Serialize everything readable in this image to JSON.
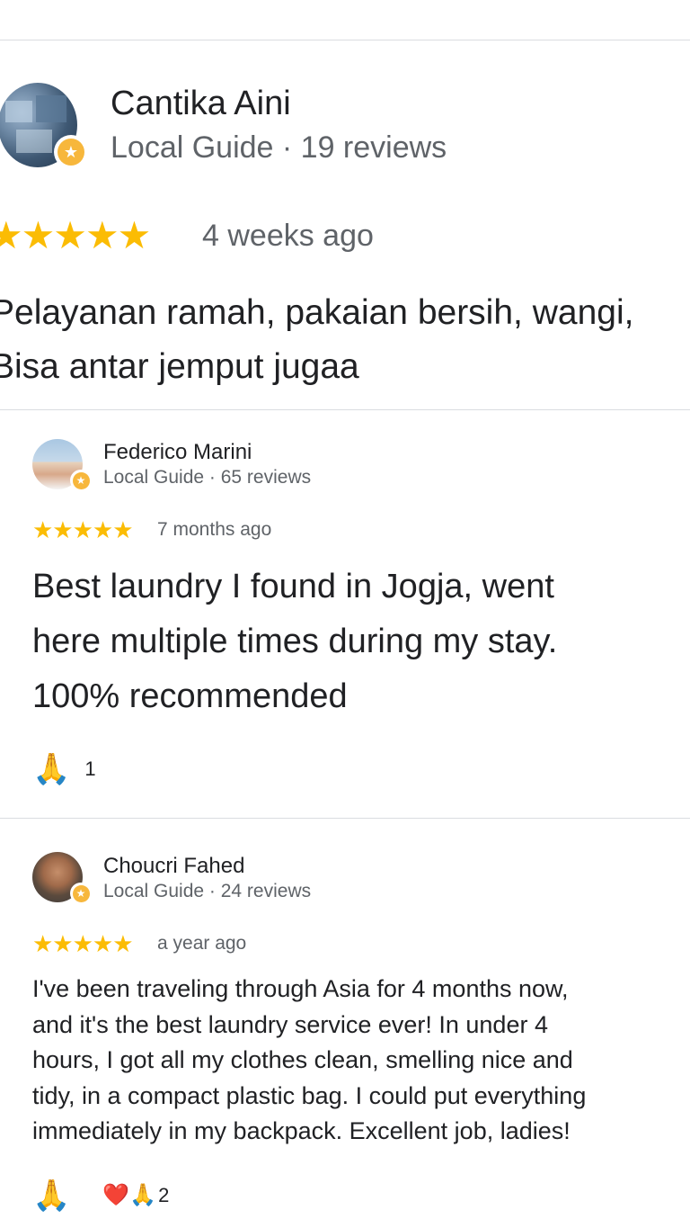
{
  "reviews": [
    {
      "name": "Cantika Aini",
      "meta": "Local Guide · 19 reviews",
      "stars": "★★★★★",
      "rating": 5,
      "time": "4 weeks ago",
      "lines": [
        "Pelayanan ramah, pakaian bersih, wangi,",
        "Bisa antar jemput jugaa"
      ]
    },
    {
      "name": "Federico Marini",
      "meta": "Local Guide · 65 reviews",
      "stars": "★★★★★",
      "rating": 5,
      "time": "7 months ago",
      "lines": [
        "Best laundry I found in Jogja, went",
        "here multiple times during my stay.",
        "100% recommended"
      ],
      "react_button_icon": "🙏",
      "reaction_count": "1"
    },
    {
      "name": "Choucri Fahed",
      "meta": "Local Guide · 24 reviews",
      "stars": "★★★★★",
      "rating": 5,
      "time": "a year ago",
      "lines": [
        "I've been traveling through Asia for 4 months now,",
        "and it's the best laundry service ever! In under 4",
        "hours, I got all my clothes clean, smelling nice and",
        "tidy, in a compact plastic bag. I could put everything",
        "immediately in my backpack. Excellent job, ladies!"
      ],
      "react_button_icon": "🙏",
      "reaction_icons": "❤️🙏",
      "reaction_count": "2"
    }
  ],
  "badge_icon": "★",
  "colors": {
    "star": "#fbbc04",
    "badge": "#f7b73c",
    "meta_text": "#5f6368",
    "divider": "#dadce0"
  }
}
